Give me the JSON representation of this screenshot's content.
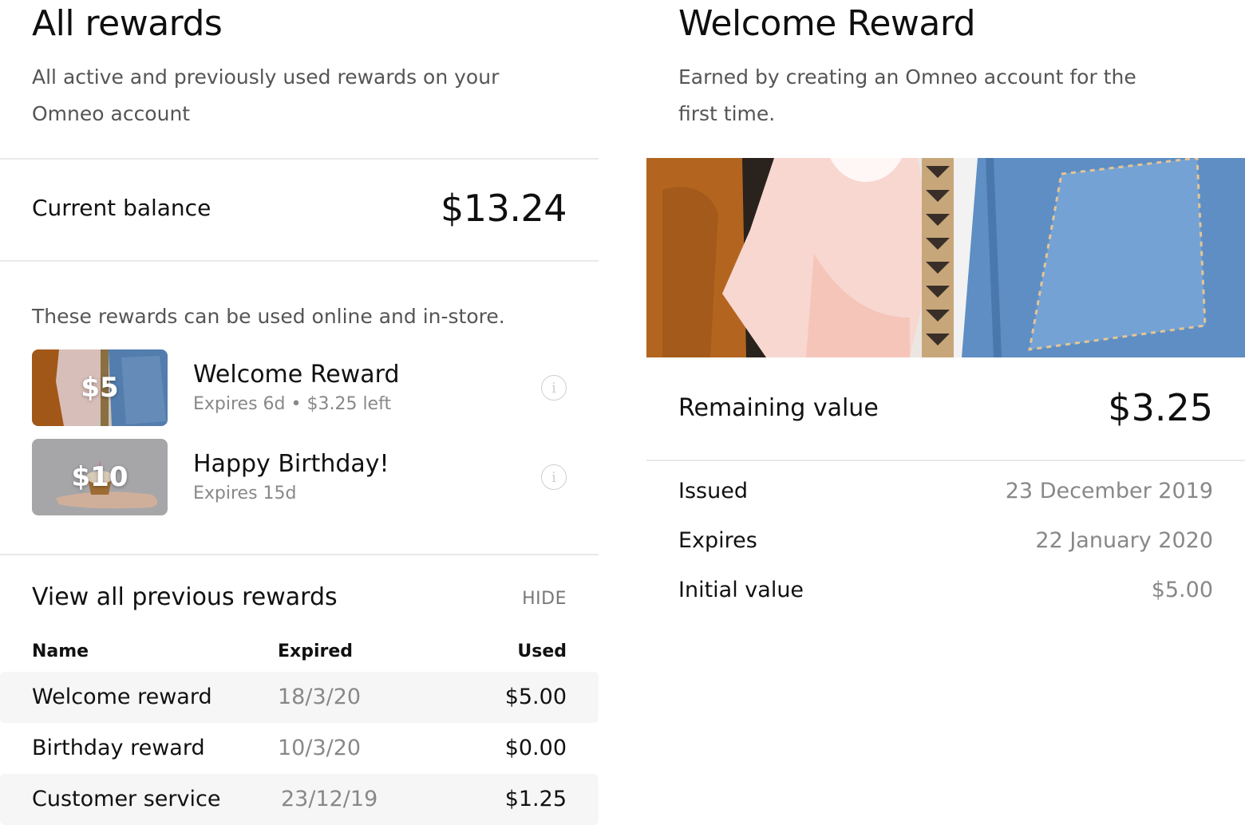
{
  "left": {
    "title": "All rewards",
    "subtitle_line1": "All active and previously used rewards on your",
    "subtitle_line2": "Omneo account",
    "balance_label": "Current balance",
    "balance_value": "$13.24",
    "hint": "These rewards can be used online and in-store.",
    "active_rewards": [
      {
        "amount": "$5",
        "name": "Welcome Reward",
        "meta": "Expires 6d • $3.25 left",
        "icon": "info-icon"
      },
      {
        "amount": "$10",
        "name": "Happy Birthday!",
        "meta": "Expires 15d",
        "icon": "info-icon"
      }
    ],
    "previous_title": "View all previous rewards",
    "hide_label": "HIDE",
    "table": {
      "headers": [
        "Name",
        "Expired",
        "Used"
      ],
      "rows": [
        {
          "name": "Welcome reward",
          "expired": "18/3/20",
          "used": "$5.00"
        },
        {
          "name": "Birthday reward",
          "expired": "10/3/20",
          "used": "$0.00"
        },
        {
          "name": "Customer service",
          "expired": "23/12/19",
          "used": "$1.25"
        }
      ]
    }
  },
  "right": {
    "title": "Welcome Reward",
    "subtitle_line1": "Earned by creating an Omneo  account for the",
    "subtitle_line2": "first time.",
    "remaining_label": "Remaining value",
    "remaining_value": "$3.25",
    "details": [
      {
        "label": "Issued",
        "value": "23 December 2019"
      },
      {
        "label": "Expires",
        "value": "22 January 2020"
      },
      {
        "label": "Initial value",
        "value": "$5.00"
      }
    ]
  }
}
